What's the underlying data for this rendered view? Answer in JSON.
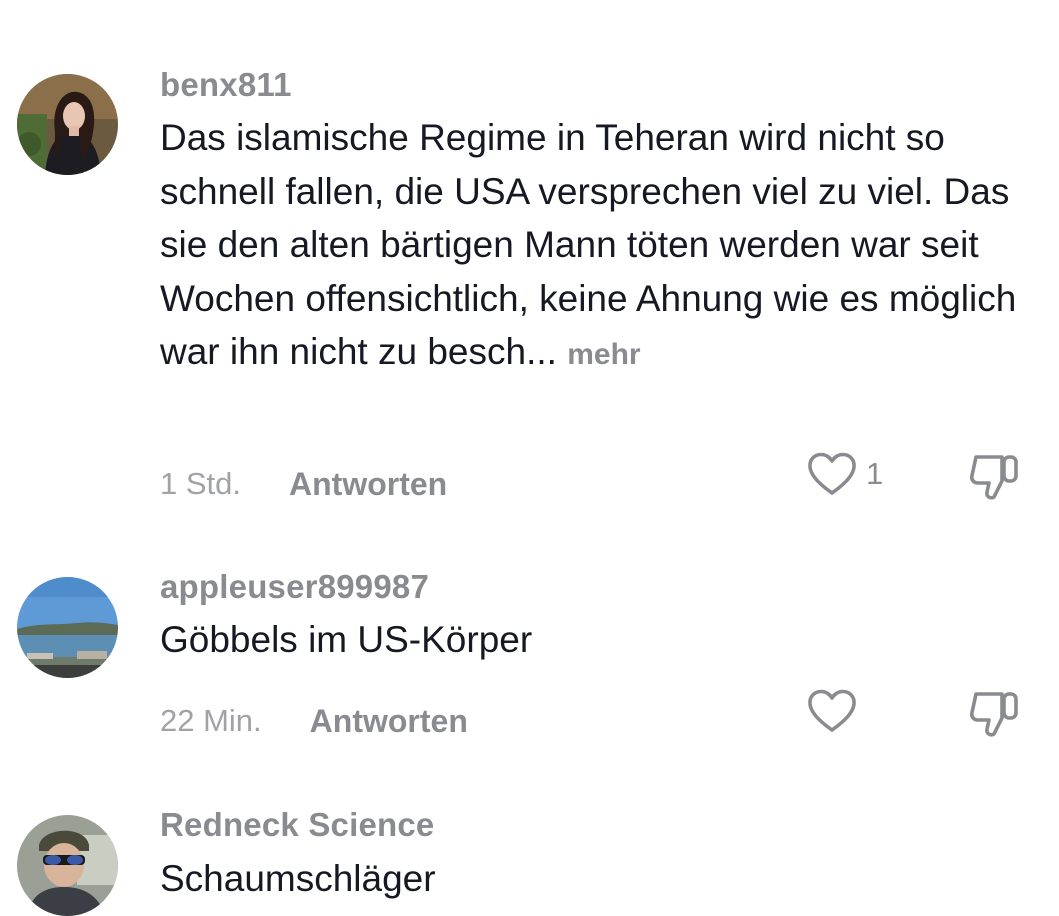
{
  "comments": [
    {
      "username": "benx811",
      "text": "Das islamische Regime in Teheran wird nicht so schnell fallen, die USA versprechen viel zu viel. Das sie den alten bärtigen Mann töten werden war seit Wochen offensichtlich, keine Ahnung wie es möglich war ihn nicht zu besch...",
      "more_label": "mehr",
      "time": "1 Std.",
      "reply_label": "Antworten",
      "like_count": "1",
      "like_icon": "heart-outline-icon",
      "dislike_icon": "thumbs-down-icon"
    },
    {
      "username": "appleuser899987",
      "text": "Göbbels im US-Körper",
      "time": "22 Min.",
      "reply_label": "Antworten",
      "like_icon": "heart-outline-icon",
      "dislike_icon": "thumbs-down-icon"
    },
    {
      "username": "Redneck Science",
      "text": "Schaumschläger"
    }
  ],
  "colors": {
    "text": "#161823",
    "secondary": "#8a8b91",
    "muted": "#a1a2a7",
    "background": "#ffffff"
  }
}
